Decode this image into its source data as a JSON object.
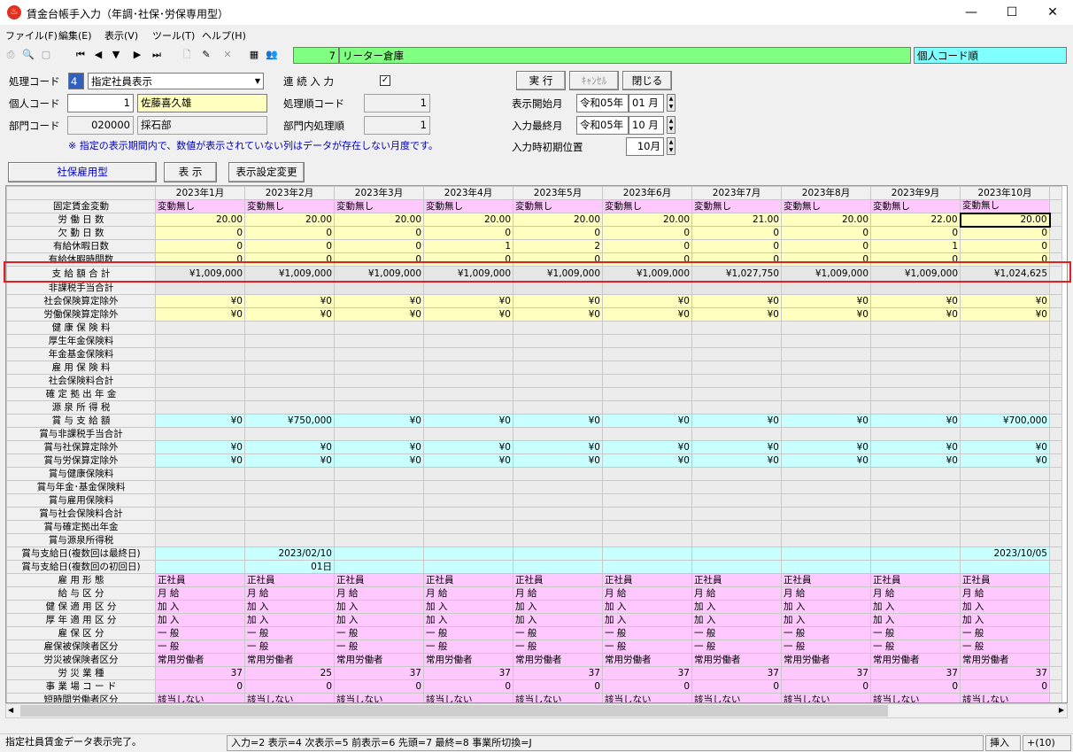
{
  "window": {
    "title": "賃金台帳手入力（年調･社保･労保専用型）",
    "min": "—",
    "max": "☐",
    "close": "✕"
  },
  "menu": [
    "ファイル(F)",
    "編集(E)",
    "表示(V)",
    "ツール(T)",
    "ヘルプ(H)"
  ],
  "toolbar": {
    "company_code": "7",
    "company_name": "リーター倉庫",
    "sort_order": "個人コード順"
  },
  "form": {
    "process_code_label": "処理コード",
    "process_code": "4",
    "process_select": "指定社員表示",
    "continuous_label": "連 続 入 力",
    "continuous_checked": "✓",
    "person_code_label": "個人コード",
    "person_code": "1",
    "person_name": "佐藤喜久雄",
    "proc_order_label": "処理順コード",
    "proc_order": "1",
    "dept_code_label": "部門コード",
    "dept_code": "020000",
    "dept_name": "採石部",
    "dept_order_label": "部門内処理順",
    "dept_order": "1",
    "note": "※ 指定の表示期間内で、数値が表示されていない列はデータが存在しない月度です。",
    "execute_btn": "実 行",
    "cancel_btn": "ｷｬﾝｾﾙ",
    "close_btn": "閉じる",
    "start_month_label": "表示開始月",
    "start_era": "令和05",
    "start_year_suffix": "年",
    "start_month": "01",
    "month_suffix": "月",
    "last_month_label": "入力最終月",
    "last_era": "令和05",
    "last_month": "10",
    "init_pos_label": "入力時初期位置",
    "init_pos": "10月",
    "type_btn": "社保雇用型",
    "display_btn": "表 示",
    "settings_btn": "表示設定変更"
  },
  "grid": {
    "columns": [
      "2023年1月",
      "2023年2月",
      "2023年3月",
      "2023年4月",
      "2023年5月",
      "2023年6月",
      "2023年7月",
      "2023年8月",
      "2023年9月",
      "2023年10月"
    ],
    "rows": [
      {
        "label": "固定賃金変動",
        "bg": "pink",
        "align": "left",
        "values": [
          "変動無し",
          "変動無し",
          "変動無し",
          "変動無し",
          "変動無し",
          "変動無し",
          "変動無し",
          "変動無し",
          "変動無し",
          "変動無し"
        ]
      },
      {
        "label": "労 働 日 数",
        "bg": "yellow",
        "values": [
          "20.00",
          "20.00",
          "20.00",
          "20.00",
          "20.00",
          "20.00",
          "21.00",
          "20.00",
          "22.00",
          "20.00"
        ]
      },
      {
        "label": "欠 勤 日 数",
        "bg": "yellow",
        "values": [
          "0",
          "0",
          "0",
          "0",
          "0",
          "0",
          "0",
          "0",
          "0",
          "0"
        ]
      },
      {
        "label": "有給休暇日数",
        "bg": "yellow",
        "values": [
          "0",
          "0",
          "0",
          "1",
          "2",
          "0",
          "0",
          "0",
          "1",
          "0"
        ]
      },
      {
        "label": "有給休暇時間数",
        "bg": "yellow",
        "values": [
          "0",
          "0",
          "0",
          "0",
          "0",
          "0",
          "0",
          "0",
          "0",
          "0"
        ]
      },
      {
        "label": "支 給 額 合 計",
        "bg": "gray",
        "values": [
          "¥1,009,000",
          "¥1,009,000",
          "¥1,009,000",
          "¥1,009,000",
          "¥1,009,000",
          "¥1,009,000",
          "¥1,027,750",
          "¥1,009,000",
          "¥1,009,000",
          "¥1,024,625"
        ]
      },
      {
        "label": "非課税手当合計",
        "bg": "gray",
        "values": [
          "",
          "",
          "",
          "",
          "",
          "",
          "",
          "",
          "",
          ""
        ]
      },
      {
        "label": "社会保険算定除外",
        "bg": "yellow",
        "values": [
          "¥0",
          "¥0",
          "¥0",
          "¥0",
          "¥0",
          "¥0",
          "¥0",
          "¥0",
          "¥0",
          "¥0"
        ]
      },
      {
        "label": "労働保険算定除外",
        "bg": "yellow",
        "values": [
          "¥0",
          "¥0",
          "¥0",
          "¥0",
          "¥0",
          "¥0",
          "¥0",
          "¥0",
          "¥0",
          "¥0"
        ]
      },
      {
        "label": "健 康 保 険 料",
        "bg": "gray2",
        "values": [
          "",
          "",
          "",
          "",
          "",
          "",
          "",
          "",
          "",
          ""
        ]
      },
      {
        "label": "厚生年金保険料",
        "bg": "gray2",
        "values": [
          "",
          "",
          "",
          "",
          "",
          "",
          "",
          "",
          "",
          ""
        ]
      },
      {
        "label": "年金基金保険料",
        "bg": "gray2",
        "values": [
          "",
          "",
          "",
          "",
          "",
          "",
          "",
          "",
          "",
          ""
        ]
      },
      {
        "label": "雇 用 保 険 料",
        "bg": "gray2",
        "values": [
          "",
          "",
          "",
          "",
          "",
          "",
          "",
          "",
          "",
          ""
        ]
      },
      {
        "label": "社会保険料合計",
        "bg": "gray2",
        "values": [
          "",
          "",
          "",
          "",
          "",
          "",
          "",
          "",
          "",
          ""
        ]
      },
      {
        "label": "確 定 拠 出 年 金",
        "bg": "gray2",
        "values": [
          "",
          "",
          "",
          "",
          "",
          "",
          "",
          "",
          "",
          ""
        ]
      },
      {
        "label": "源 泉 所 得 税",
        "bg": "gray2",
        "values": [
          "",
          "",
          "",
          "",
          "",
          "",
          "",
          "",
          "",
          ""
        ]
      },
      {
        "label": "賞 与 支 給 額",
        "bg": "cyan",
        "values": [
          "¥0",
          "¥750,000",
          "¥0",
          "¥0",
          "¥0",
          "¥0",
          "¥0",
          "¥0",
          "¥0",
          "¥700,000"
        ]
      },
      {
        "label": "賞与非課税手当合計",
        "bg": "gray2",
        "values": [
          "",
          "",
          "",
          "",
          "",
          "",
          "",
          "",
          "",
          ""
        ]
      },
      {
        "label": "賞与社保算定除外",
        "bg": "cyan",
        "values": [
          "¥0",
          "¥0",
          "¥0",
          "¥0",
          "¥0",
          "¥0",
          "¥0",
          "¥0",
          "¥0",
          "¥0"
        ]
      },
      {
        "label": "賞与労保算定除外",
        "bg": "cyan",
        "values": [
          "¥0",
          "¥0",
          "¥0",
          "¥0",
          "¥0",
          "¥0",
          "¥0",
          "¥0",
          "¥0",
          "¥0"
        ]
      },
      {
        "label": "賞与健康保険料",
        "bg": "gray2",
        "values": [
          "",
          "",
          "",
          "",
          "",
          "",
          "",
          "",
          "",
          ""
        ]
      },
      {
        "label": "賞与年金･基金保険料",
        "bg": "gray2",
        "values": [
          "",
          "",
          "",
          "",
          "",
          "",
          "",
          "",
          "",
          ""
        ]
      },
      {
        "label": "賞与雇用保険料",
        "bg": "gray2",
        "values": [
          "",
          "",
          "",
          "",
          "",
          "",
          "",
          "",
          "",
          ""
        ]
      },
      {
        "label": "賞与社会保険料合計",
        "bg": "gray2",
        "values": [
          "",
          "",
          "",
          "",
          "",
          "",
          "",
          "",
          "",
          ""
        ]
      },
      {
        "label": "賞与確定拠出年金",
        "bg": "gray2",
        "values": [
          "",
          "",
          "",
          "",
          "",
          "",
          "",
          "",
          "",
          ""
        ]
      },
      {
        "label": "賞与源泉所得税",
        "bg": "gray2",
        "values": [
          "",
          "",
          "",
          "",
          "",
          "",
          "",
          "",
          "",
          ""
        ]
      },
      {
        "label": "賞与支給日(複数回は最終日)",
        "bg": "cyan",
        "values": [
          "",
          "2023/02/10",
          "",
          "",
          "",
          "",
          "",
          "",
          "",
          "2023/10/05"
        ]
      },
      {
        "label": "賞与支給日(複数回の初回日)",
        "bg": "cyan",
        "values": [
          "",
          "01日",
          "",
          "",
          "",
          "",
          "",
          "",
          "",
          ""
        ]
      },
      {
        "label": "雇 用 形 態",
        "bg": "pink",
        "align": "left",
        "values": [
          "正社員",
          "正社員",
          "正社員",
          "正社員",
          "正社員",
          "正社員",
          "正社員",
          "正社員",
          "正社員",
          "正社員"
        ]
      },
      {
        "label": "給 与 区 分",
        "bg": "pink",
        "align": "left",
        "values": [
          "月 給",
          "月 給",
          "月 給",
          "月 給",
          "月 給",
          "月 給",
          "月 給",
          "月 給",
          "月 給",
          "月 給"
        ]
      },
      {
        "label": "健 保 適 用 区 分",
        "bg": "pink",
        "align": "left",
        "values": [
          "加 入",
          "加 入",
          "加 入",
          "加 入",
          "加 入",
          "加 入",
          "加 入",
          "加 入",
          "加 入",
          "加 入"
        ]
      },
      {
        "label": "厚 年 適 用 区 分",
        "bg": "pink",
        "align": "left",
        "values": [
          "加 入",
          "加 入",
          "加 入",
          "加 入",
          "加 入",
          "加 入",
          "加 入",
          "加 入",
          "加 入",
          "加 入"
        ]
      },
      {
        "label": "雇 保 区 分",
        "bg": "pink",
        "align": "left",
        "values": [
          "一 般",
          "一 般",
          "一 般",
          "一 般",
          "一 般",
          "一 般",
          "一 般",
          "一 般",
          "一 般",
          "一 般"
        ]
      },
      {
        "label": "雇保被保険者区分",
        "bg": "pink",
        "align": "left",
        "values": [
          "一 般",
          "一 般",
          "一 般",
          "一 般",
          "一 般",
          "一 般",
          "一 般",
          "一 般",
          "一 般",
          "一 般"
        ]
      },
      {
        "label": "労災被保険者区分",
        "bg": "pink",
        "align": "left",
        "values": [
          "常用労働者",
          "常用労働者",
          "常用労働者",
          "常用労働者",
          "常用労働者",
          "常用労働者",
          "常用労働者",
          "常用労働者",
          "常用労働者",
          "常用労働者"
        ]
      },
      {
        "label": "労 災 業 種",
        "bg": "pink",
        "values": [
          "37",
          "25",
          "37",
          "37",
          "37",
          "37",
          "37",
          "37",
          "37",
          "37"
        ]
      },
      {
        "label": "事 業 場 コ ー ド",
        "bg": "pink",
        "values": [
          "0",
          "0",
          "0",
          "0",
          "0",
          "0",
          "0",
          "0",
          "0",
          "0"
        ]
      },
      {
        "label": "短時間労働者区分",
        "bg": "pink",
        "align": "left",
        "values": [
          "該当しない",
          "該当しない",
          "該当しない",
          "該当しない",
          "該当しない",
          "該当しない",
          "該当しない",
          "該当しない",
          "該当しない",
          "該当しない"
        ]
      }
    ]
  },
  "status": {
    "message": "指定社員賃金データ表示完了。",
    "keys": "入力=2 表示=4 次表示=5 前表示=6 先頭=7 最終=8 事業所切換=J",
    "mode": "挿入",
    "count": "+(10)"
  }
}
